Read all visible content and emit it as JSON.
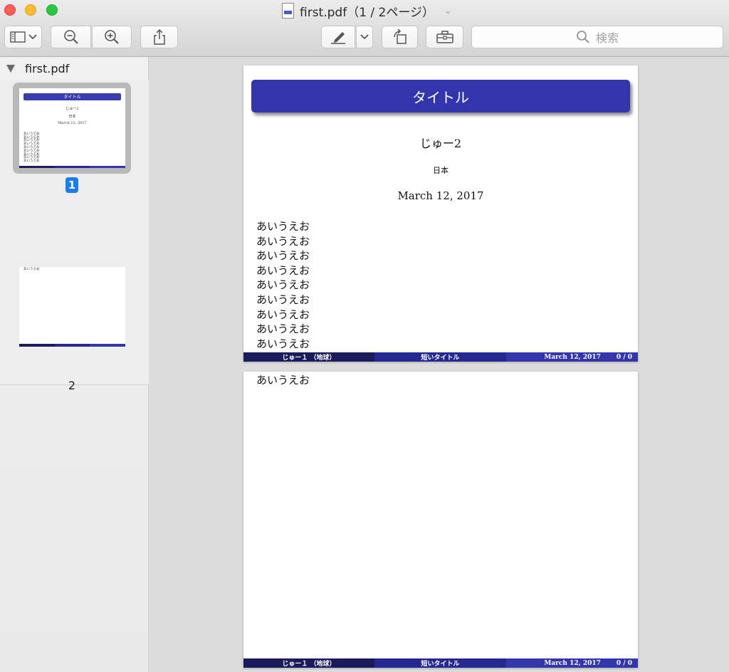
{
  "window": {
    "title": "first.pdf（1 / 2ページ）",
    "title_chevron": "⌄"
  },
  "toolbar": {
    "search_placeholder": "検索",
    "buttons": [
      {
        "name": "sidebar-toggle",
        "icon": "sidebar-icon"
      },
      {
        "name": "zoom-out",
        "icon": "zoom-out-icon"
      },
      {
        "name": "zoom-in",
        "icon": "zoom-in-icon"
      },
      {
        "name": "share",
        "icon": "share-icon"
      },
      {
        "name": "markup",
        "icon": "pen-icon"
      },
      {
        "name": "markup-menu",
        "icon": "chevron-down-icon"
      },
      {
        "name": "rotate",
        "icon": "rotate-icon"
      },
      {
        "name": "toolbox",
        "icon": "toolbox-icon"
      }
    ]
  },
  "sidebar": {
    "file_name": "first.pdf",
    "pages": [
      {
        "label": "1",
        "selected": true
      },
      {
        "label": "2",
        "selected": false
      }
    ]
  },
  "document": {
    "accent_color": "#3335ad",
    "slide_title": "タイトル",
    "author": "じゅー2",
    "institute": "日本",
    "date": "March 12, 2017",
    "line": "あいうえお",
    "page1_line_count": 9,
    "page2_line_count": 1,
    "footer": {
      "left": "じゅー１ （地球）",
      "center": "短いタイトル",
      "date": "March 12, 2017",
      "page": "0 / 0"
    }
  }
}
